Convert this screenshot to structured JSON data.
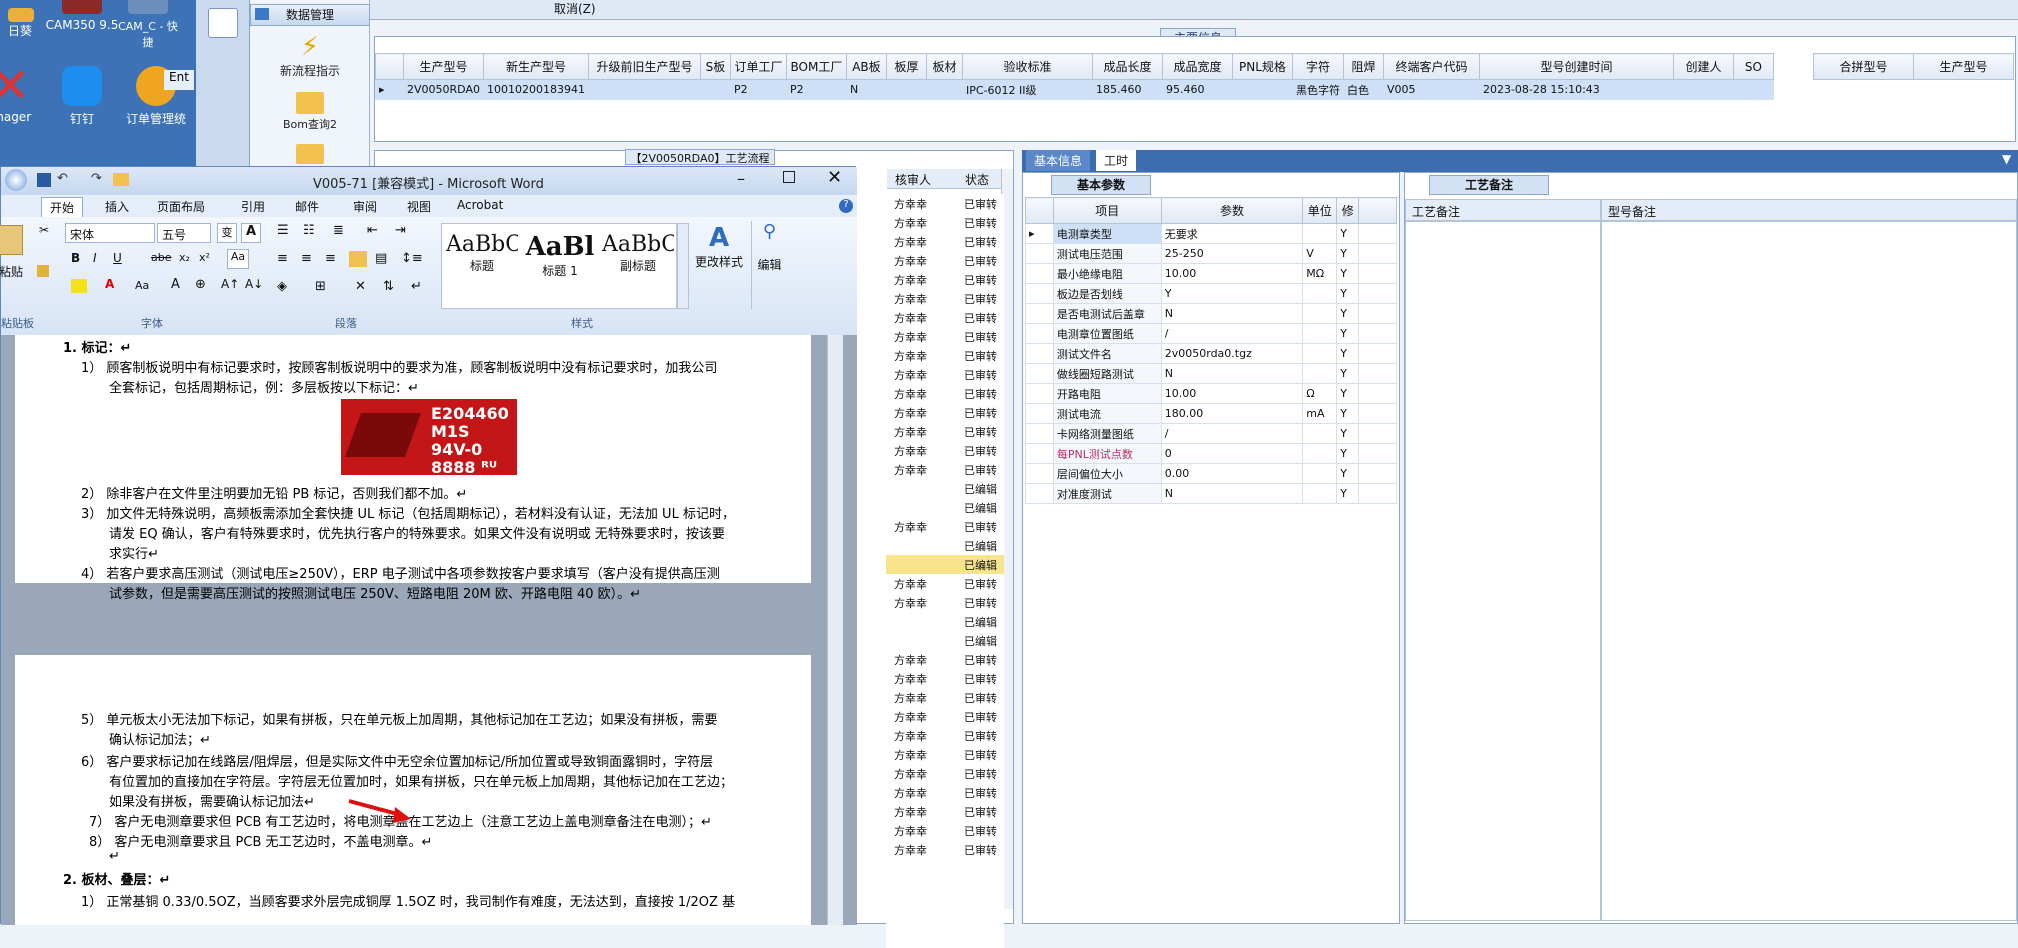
{
  "desktop": {
    "icons": [
      {
        "label": "日葵"
      },
      {
        "label": "CAM350 9.5"
      },
      {
        "label": "CAM_C - 快捷"
      },
      {
        "label": "anager"
      },
      {
        "label": "钉钉"
      },
      {
        "label": "订单管理统"
      },
      {
        "label": "Ent"
      }
    ]
  },
  "leftnav": {
    "header": "数据管理",
    "items": [
      "新流程指示",
      "Bom查询2"
    ]
  },
  "topbar": {
    "cancel_label": "取消(Z)"
  },
  "maininfo": {
    "title": "主要信息",
    "columns": [
      "生产型号",
      "新生产型号",
      "升级前旧生产型号",
      "S板",
      "订单工厂",
      "BOM工厂",
      "AB板",
      "板厚",
      "板材",
      "验收标准",
      "成品长度",
      "成品宽度",
      "PNL规格",
      "字符",
      "阻焊",
      "终端客户代码",
      "型号创建时间",
      "创建人",
      "SO"
    ],
    "row": [
      "2V0050RDA0",
      "10010200183941",
      "",
      "",
      "P2",
      "P2",
      "N",
      "",
      "",
      "IPC-6012 II级",
      "185.460",
      "95.460",
      "",
      "黑色字符",
      "白色",
      "V005",
      "2023-08-28 15:10:43",
      "",
      ""
    ],
    "side_columns": [
      "合拼型号",
      "生产型号"
    ]
  },
  "process": {
    "title": "【2V0050RDA0】工艺流程",
    "col_auditor": "核审人",
    "col_status": "状态",
    "rows": [
      {
        "auditor": "方幸幸",
        "status": "已审转"
      },
      {
        "auditor": "方幸幸",
        "status": "已审转"
      },
      {
        "auditor": "方幸幸",
        "status": "已审转"
      },
      {
        "auditor": "方幸幸",
        "status": "已审转"
      },
      {
        "auditor": "方幸幸",
        "status": "已审转"
      },
      {
        "auditor": "方幸幸",
        "status": "已审转"
      },
      {
        "auditor": "方幸幸",
        "status": "已审转"
      },
      {
        "auditor": "方幸幸",
        "status": "已审转"
      },
      {
        "auditor": "方幸幸",
        "status": "已审转"
      },
      {
        "auditor": "方幸幸",
        "status": "已审转"
      },
      {
        "auditor": "方幸幸",
        "status": "已审转"
      },
      {
        "auditor": "方幸幸",
        "status": "已审转"
      },
      {
        "auditor": "方幸幸",
        "status": "已审转"
      },
      {
        "auditor": "方幸幸",
        "status": "已审转"
      },
      {
        "auditor": "方幸幸",
        "status": "已审转"
      },
      {
        "auditor": "",
        "status": "已编辑"
      },
      {
        "auditor": "",
        "status": "已编辑"
      },
      {
        "auditor": "方幸幸",
        "status": "已审转"
      },
      {
        "auditor": "",
        "status": "已编辑"
      },
      {
        "auditor": "",
        "status": "已编辑"
      },
      {
        "auditor": "方幸幸",
        "status": "已审转"
      },
      {
        "auditor": "方幸幸",
        "status": "已审转"
      },
      {
        "auditor": "",
        "status": "已编辑"
      },
      {
        "auditor": "",
        "status": "已编辑"
      },
      {
        "auditor": "方幸幸",
        "status": "已审转"
      },
      {
        "auditor": "方幸幸",
        "status": "已审转"
      },
      {
        "auditor": "方幸幸",
        "status": "已审转"
      },
      {
        "auditor": "方幸幸",
        "status": "已审转"
      },
      {
        "auditor": "方幸幸",
        "status": "已审转"
      },
      {
        "auditor": "方幸幸",
        "status": "已审转"
      },
      {
        "auditor": "方幸幸",
        "status": "已审转"
      },
      {
        "auditor": "方幸幸",
        "status": "已审转"
      },
      {
        "auditor": "方幸幸",
        "status": "已审转"
      },
      {
        "auditor": "方幸幸",
        "status": "已审转"
      },
      {
        "auditor": "方幸幸",
        "status": "已审转"
      }
    ]
  },
  "word": {
    "title": "V005-71 [兼容模式] - Microsoft Word",
    "tabs": [
      "开始",
      "插入",
      "页面布局",
      "引用",
      "邮件",
      "审阅",
      "视图",
      "Acrobat"
    ],
    "font_name": "宋体",
    "font_size": "五号",
    "groups": [
      "字体",
      "段落",
      "样式",
      "粘贴板"
    ],
    "styles": [
      {
        "preview": "AaBbC",
        "name": "标题"
      },
      {
        "preview": "AaBl",
        "name": "标题 1"
      },
      {
        "preview": "AaBbC",
        "name": "副标题"
      }
    ],
    "change_style": "更改样式",
    "edit_label": "编辑",
    "paste_label": "粘贴",
    "logo_lines": [
      "E204460",
      "M1S 94V-0",
      "8888 ᴿᵁ"
    ],
    "p1": [
      "1.  标记：↵",
      "1） 顾客制板说明中有标记要求时，按顾客制板说明中的要求为准，顾客制板说明中没有标记要求时，加我公司",
      "全套标记，包括周期标记，例：多层板按以下标记：↵",
      "2） 除非客户在文件里注明要加无铅 PB 标记，否则我们都不加。↵",
      "3） 加文件无特殊说明，高频板需添加全套快捷 UL 标记（包括周期标记），若材料没有认证，无法加 UL 标记时，",
      "请发 EQ 确认，客户有特殊要求时，优先执行客户的特殊要求。如果文件没有说明或 无特殊要求时，按该要",
      "求实行↵",
      "4） 若客户要求高压测试（测试电压≥250V），ERP 电子测试中各项参数按客户要求填写（客户没有提供高压测",
      "试参数，但是需要高压测试的按照测试电压 250V、短路电阻 20M 欧、开路电阻 40 欧）。↵"
    ],
    "p2": [
      "5） 单元板太小无法加下标记，如果有拼板，只在单元板上加周期，其他标记加在工艺边；如果没有拼板，需要",
      "确认标记加法；↵",
      "6） 客户要求标记加在线路层/阻焊层，但是实际文件中无空余位置加标记/所加位置或导致铜面露铜时，字符层",
      "有位置加的直接加在字符层。字符层无位置加时，如果有拼板，只在单元板上加周期，其他标记加在工艺边；",
      "如果没有拼板，需要确认标记加法↵",
      "7） 客户无电测章要求但 PCB 有工艺边时，将电测章盖在工艺边上（注意工艺边上盖电测章备注在电测）；↵",
      "8） 客户无电测章要求且 PCB 无工艺边时，不盖电测章。↵",
      "↵",
      "2.  板材、叠层：↵",
      "1） 正常基铜 0.33/0.5OZ，当顾客要求外层完成铜厚 1.5OZ 时，我司制作有难度，无法达到，直接按 1/2OZ 基"
    ]
  },
  "basic": {
    "tabs": [
      "基本信息",
      "工时"
    ],
    "params_tab": "基本参数",
    "headers": [
      "项目",
      "参数",
      "单位",
      "修"
    ],
    "rows": [
      {
        "item": "电测章类型",
        "value": "无要求",
        "unit": "",
        "flag": "Y"
      },
      {
        "item": "测试电压范围",
        "value": "25-250",
        "unit": "V",
        "flag": "Y"
      },
      {
        "item": "最小绝缘电阻",
        "value": "10.00",
        "unit": "MΩ",
        "flag": "Y"
      },
      {
        "item": "板边是否划线",
        "value": "Y",
        "unit": "",
        "flag": "Y"
      },
      {
        "item": "是否电测试后盖章",
        "value": "N",
        "unit": "",
        "flag": "Y"
      },
      {
        "item": "电测章位置图纸",
        "value": "/",
        "unit": "",
        "flag": "Y"
      },
      {
        "item": "测试文件名",
        "value": "2v0050rda0.tgz",
        "unit": "",
        "flag": "Y"
      },
      {
        "item": "做线圈短路测试",
        "value": "N",
        "unit": "",
        "flag": "Y"
      },
      {
        "item": "开路电阻",
        "value": "10.00",
        "unit": "Ω",
        "flag": "Y"
      },
      {
        "item": "测试电流",
        "value": "180.00",
        "unit": "mA",
        "flag": "Y"
      },
      {
        "item": "卡网络测量图纸",
        "value": "/",
        "unit": "",
        "flag": "Y"
      },
      {
        "item": "每PNL测试点数",
        "value": "0",
        "unit": "",
        "flag": "Y"
      },
      {
        "item": "层间偏位大小",
        "value": "0.00",
        "unit": "",
        "flag": "Y"
      },
      {
        "item": "对准度测试",
        "value": "N",
        "unit": "",
        "flag": "Y"
      }
    ]
  },
  "notes": {
    "tab": "工艺备注",
    "col1": "工艺备注",
    "col2": "型号备注"
  }
}
